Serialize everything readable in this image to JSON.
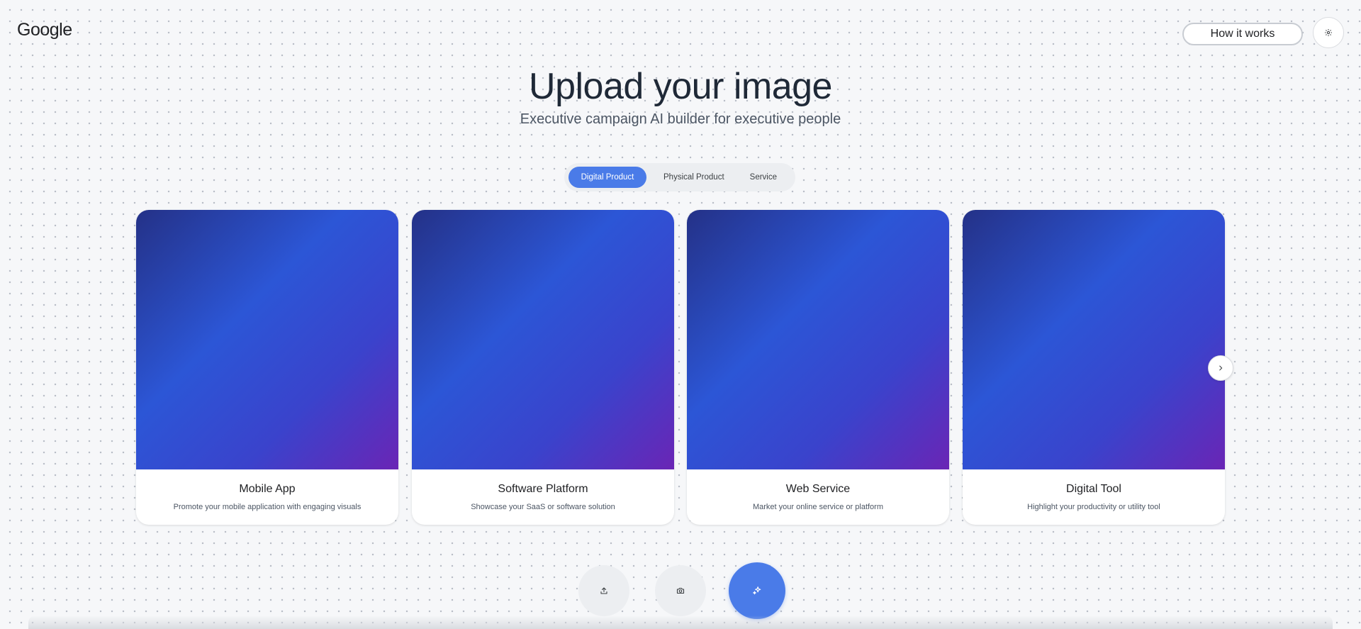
{
  "header": {
    "logo": "Google",
    "how_it_works_label": "How it works",
    "settings_icon": "gear-icon"
  },
  "hero": {
    "title": "Upload your image",
    "subtitle": "Executive campaign AI builder for executive people"
  },
  "tabs": [
    {
      "label": "Digital Product",
      "active": true
    },
    {
      "label": "Physical Product",
      "active": false
    },
    {
      "label": "Service",
      "active": false
    }
  ],
  "cards": [
    {
      "title": "Mobile App",
      "description": "Promote your mobile application with engaging visuals"
    },
    {
      "title": "Software Platform",
      "description": "Showcase your SaaS or software solution"
    },
    {
      "title": "Web Service",
      "description": "Market your online service or platform"
    },
    {
      "title": "Digital Tool",
      "description": "Highlight your productivity or utility tool"
    }
  ],
  "carousel": {
    "next_icon": "chevron-right-icon"
  },
  "actions": {
    "upload_icon": "upload-icon",
    "camera_icon": "camera-icon",
    "generate_icon": "sparkle-icon"
  },
  "colors": {
    "accent": "#4a7be8",
    "background": "#f6f7f9",
    "card_gradient_start": "#243187",
    "card_gradient_end": "#6a25b5"
  }
}
